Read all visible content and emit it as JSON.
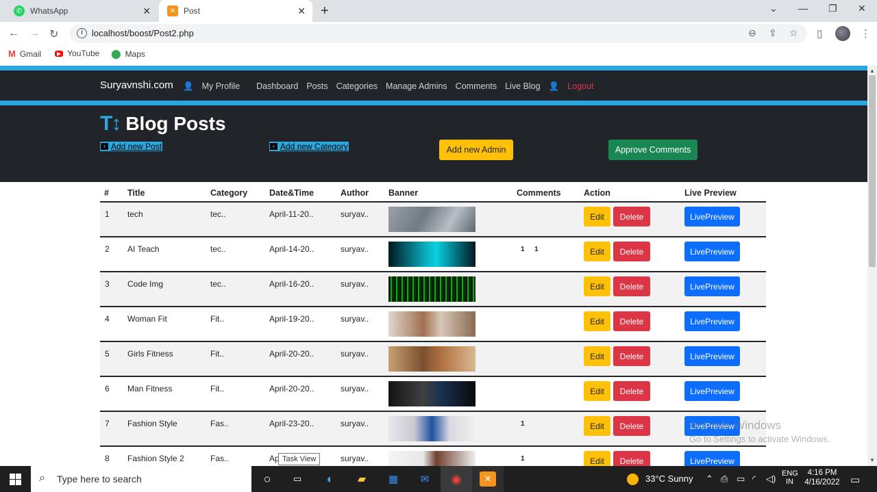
{
  "browser": {
    "tabs": [
      {
        "title": "WhatsApp",
        "close": "✕"
      },
      {
        "title": "Post",
        "close": "✕"
      }
    ],
    "url": "localhost/boost/Post2.php",
    "bookmarks": [
      "Gmail",
      "YouTube",
      "Maps"
    ]
  },
  "navbar": {
    "brand": "Suryavnshi.com",
    "links": [
      "My Profile",
      "Dashboard",
      "Posts",
      "Categories",
      "Manage Admins",
      "Comments",
      "Live Blog",
      "Logout"
    ]
  },
  "header": {
    "title": "Blog Posts",
    "add_post": "Add new Post",
    "add_category": "Add new Category",
    "add_admin": "Add new Admin",
    "approve_comments": "Approve Comments"
  },
  "table": {
    "columns": [
      "#",
      "Title",
      "Category",
      "Date&Time",
      "Author",
      "Banner",
      "Comments",
      "Action",
      "Live Preview"
    ],
    "buttons": {
      "edit": "Edit",
      "delete": "Delete",
      "live": "LivePreview"
    },
    "rows": [
      {
        "n": "1",
        "title": "tech",
        "category": "tec..",
        "date": "April-11-20..",
        "author": "suryav..",
        "approved": "",
        "pending": ""
      },
      {
        "n": "2",
        "title": "AI Teach",
        "category": "tec..",
        "date": "April-14-20..",
        "author": "suryav..",
        "approved": "1",
        "pending": "1"
      },
      {
        "n": "3",
        "title": "Code Img",
        "category": "tec..",
        "date": "April-16-20..",
        "author": "suryav..",
        "approved": "",
        "pending": ""
      },
      {
        "n": "4",
        "title": "Woman Fit",
        "category": "Fit..",
        "date": "April-19-20..",
        "author": "suryav..",
        "approved": "",
        "pending": ""
      },
      {
        "n": "5",
        "title": "Girls Fitness",
        "category": "Fit..",
        "date": "April-20-20..",
        "author": "suryav..",
        "approved": "",
        "pending": ""
      },
      {
        "n": "6",
        "title": "Man Fitness",
        "category": "Fit..",
        "date": "April-20-20..",
        "author": "suryav..",
        "approved": "",
        "pending": ""
      },
      {
        "n": "7",
        "title": "Fashion Style",
        "category": "Fas..",
        "date": "April-23-20..",
        "author": "suryav..",
        "approved": "1",
        "pending": ""
      },
      {
        "n": "8",
        "title": "Fashion Style 2",
        "category": "Fas..",
        "date": "Ap",
        "author": "suryav..",
        "approved": "1",
        "pending": ""
      }
    ]
  },
  "tooltip": "Task View",
  "watermark": {
    "line1": "Activate Windows",
    "line2": "Go to Settings to activate Windows."
  },
  "taskbar": {
    "search_placeholder": "Type here to search",
    "weather": "33°C  Sunny",
    "lang1": "ENG",
    "lang2": "IN",
    "time": "4:16 PM",
    "date": "4/16/2022"
  },
  "colors": {
    "accent_blue": "#29a8e0",
    "navbar_dark": "#212529",
    "warning": "#ffc107",
    "danger": "#dc3545",
    "primary": "#0d6efd",
    "success": "#198754"
  }
}
